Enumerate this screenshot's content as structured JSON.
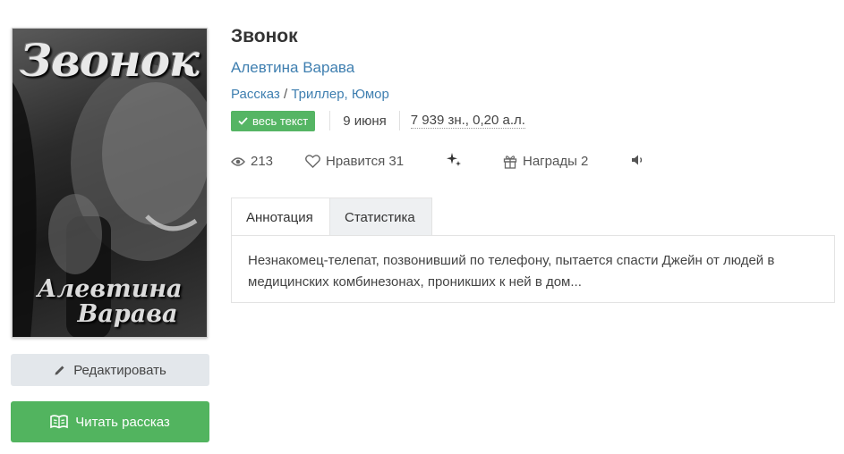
{
  "cover": {
    "title": "Звонок",
    "author_line1": "Алевтина",
    "author_line2": "Варава"
  },
  "book": {
    "title": "Звонок",
    "author": "Алевтина Варава",
    "form": "Рассказ",
    "genre_sep": "/",
    "genres": "Триллер, Юмор",
    "badge": "весь текст",
    "date": "9 июня",
    "size": "7 939 зн., 0,20 а.л."
  },
  "stats": {
    "views": "213",
    "likes": "Нравится 31",
    "awards": "Награды 2"
  },
  "icons": {
    "views": "eye-icon",
    "likes": "heart-icon",
    "sparkle": "sparkles-icon",
    "awards": "gift-icon",
    "audio": "speaker-icon",
    "edit": "pencil-icon",
    "read": "open-book-icon",
    "badge": "check-icon"
  },
  "tabs": {
    "annotation": "Аннотация",
    "statistics": "Статистика"
  },
  "annotation": "Незнакомец-телепат, позвонивший по телефону, пытается спасти Джейн от людей в медицинских комбинезонах, проникших к ней в дом...",
  "buttons": {
    "edit": "Редактировать",
    "read": "Читать рассказ"
  },
  "colors": {
    "link": "#3f7fb0",
    "green": "#52b45f",
    "edit_bg": "#e3e7eb"
  }
}
